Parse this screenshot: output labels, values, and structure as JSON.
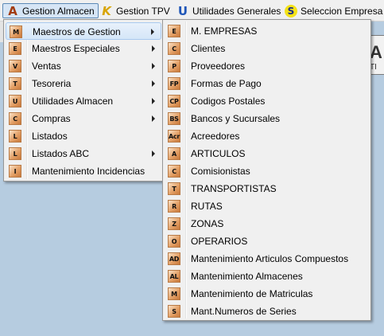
{
  "menubar": [
    {
      "label": "Gestion Almacen",
      "icon": "A",
      "active": true
    },
    {
      "label": "Gestion TPV",
      "icon": "K"
    },
    {
      "label": "Utilidades Generales",
      "icon": "U"
    },
    {
      "label": "Seleccion Empresa",
      "icon": "S"
    }
  ],
  "background": {
    "big": "A",
    "small": "TI"
  },
  "main_menu": [
    {
      "badge": "M",
      "label": "Maestros de Gestion",
      "submenu": true
    },
    {
      "badge": "E",
      "label": "Maestros Especiales",
      "submenu": true
    },
    {
      "badge": "V",
      "label": "Ventas",
      "submenu": true
    },
    {
      "badge": "T",
      "label": "Tesoreria",
      "submenu": true
    },
    {
      "badge": "U",
      "label": "Utilidades Almacen",
      "submenu": true
    },
    {
      "badge": "C",
      "label": "Compras",
      "submenu": true
    },
    {
      "badge": "L",
      "label": "Listados",
      "submenu": false
    },
    {
      "badge": "L",
      "label": "Listados ABC",
      "submenu": true
    },
    {
      "badge": "I",
      "label": "Mantenimiento Incidencias",
      "submenu": false
    }
  ],
  "sub_menu": [
    {
      "badge": "E",
      "label": "M. EMPRESAS"
    },
    {
      "badge": "C",
      "label": "Clientes"
    },
    {
      "badge": "P",
      "label": "Proveedores"
    },
    {
      "badge": "FP",
      "label": "Formas de Pago"
    },
    {
      "badge": "CP",
      "label": "Codigos Postales"
    },
    {
      "badge": "BS",
      "label": "Bancos y Sucursales"
    },
    {
      "badge": "Acr",
      "label": "Acreedores"
    },
    {
      "badge": "A",
      "label": "ARTICULOS"
    },
    {
      "badge": "C",
      "label": "Comisionistas"
    },
    {
      "badge": "T",
      "label": "TRANSPORTISTAS"
    },
    {
      "badge": "R",
      "label": "RUTAS"
    },
    {
      "badge": "Z",
      "label": "ZONAS"
    },
    {
      "badge": "O",
      "label": "OPERARIOS"
    },
    {
      "badge": "AD",
      "label": "Mantenimiento Articulos Compuestos"
    },
    {
      "badge": "AL",
      "label": "Mantenimiento Almacenes"
    },
    {
      "badge": "M",
      "label": "Mantenimiento de Matriculas"
    },
    {
      "badge": "S",
      "label": "Mant.Numeros de Series"
    }
  ],
  "colors": {
    "highlight": "#d5e6f8",
    "badge": "#e3a066",
    "menubar": "#f0f0f0",
    "desktop": "#b6cce0"
  }
}
